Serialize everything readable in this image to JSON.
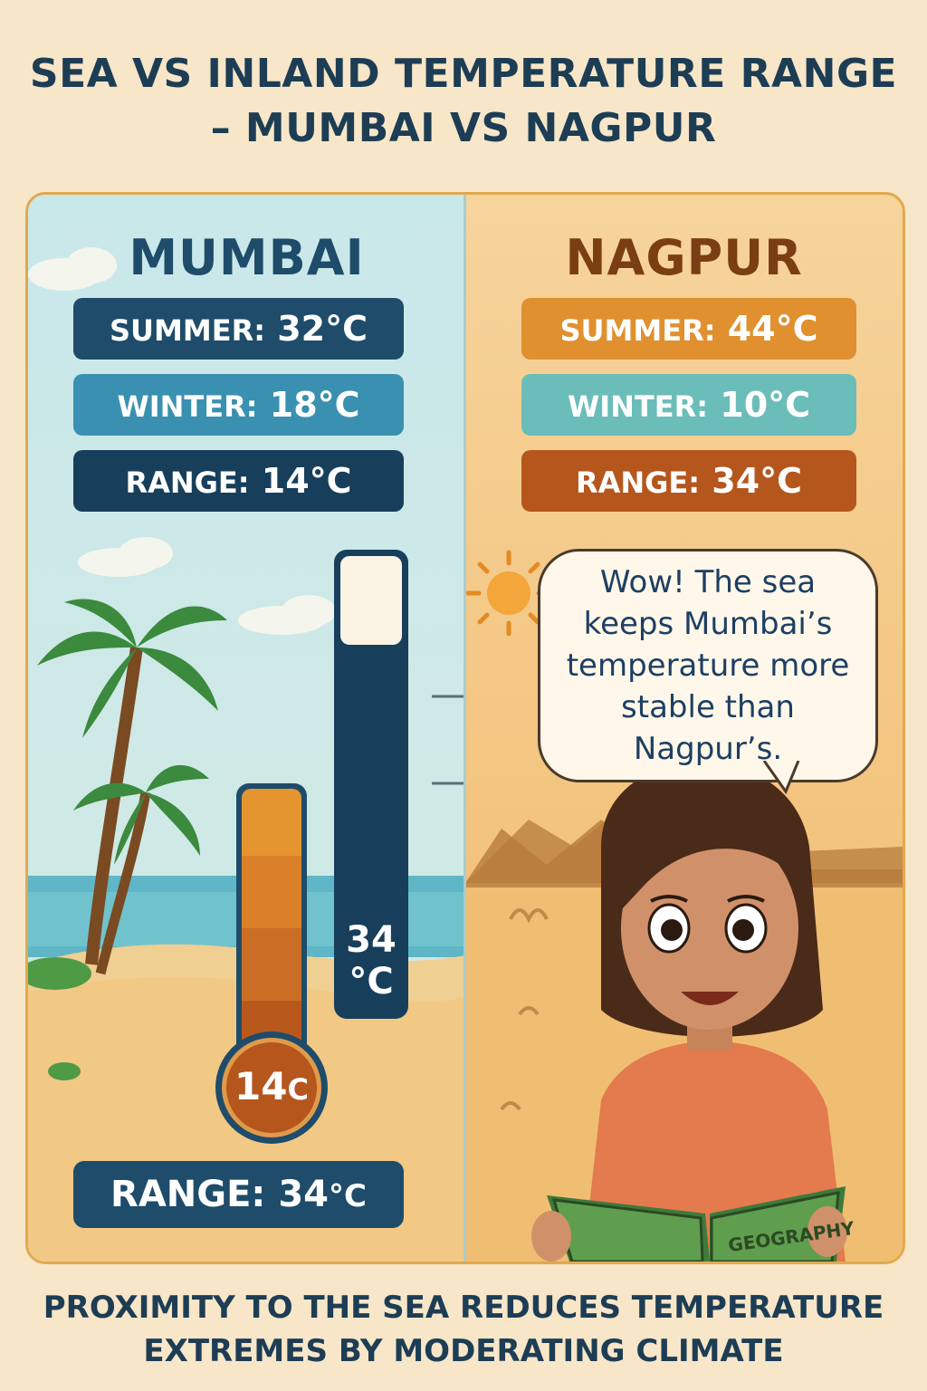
{
  "title": {
    "line1": "SEA VS INLAND TEMPERATURE RANGE",
    "line2": "– MUMBAI VS NAGPUR"
  },
  "mumbai": {
    "name": "MUMBAI",
    "summer_label": "SUMMER:",
    "summer_value": "32°C",
    "winter_label": "WINTER:",
    "winter_value": "18°C",
    "range_label": "RANGE:",
    "range_value": "14°C"
  },
  "nagpur": {
    "name": "NAGPUR",
    "summer_label": "SUMMER:",
    "summer_value": "44°C",
    "winter_label": "WINTER:",
    "winter_value": "10°C",
    "range_label": "RANGE:",
    "range_value": "34°C"
  },
  "thermometers": {
    "small_label": "14",
    "small_unit": "C",
    "tall_label_number": "34",
    "tall_label_unit": "°C"
  },
  "bottom_range": {
    "label": "RANGE: 34",
    "unit": "°C"
  },
  "speech_bubble": "Wow! The sea keeps Mumbai’s temperature more stable than Nagpur’s.",
  "book_title": "GEOGRAPHY",
  "footer": {
    "line1": "PROXIMITY TO THE SEA REDUCES TEMPERATURE",
    "line2": "EXTREMES BY MODERATING CLIMATE"
  },
  "colors": {
    "navy": "#1e4c6a",
    "dark_navy": "#173f5c",
    "teal_blue": "#3a90b0",
    "orange": "#e0902f",
    "light_teal": "#6bbdb9",
    "rust": "#b5561d",
    "nagpur_title": "#7a3e12",
    "mumbai_title": "#1e4c6a"
  },
  "icons": [
    "palm-tree-icon",
    "sun-icon",
    "cloud-icon",
    "thermometer-icon",
    "book-icon",
    "girl-illustration"
  ]
}
